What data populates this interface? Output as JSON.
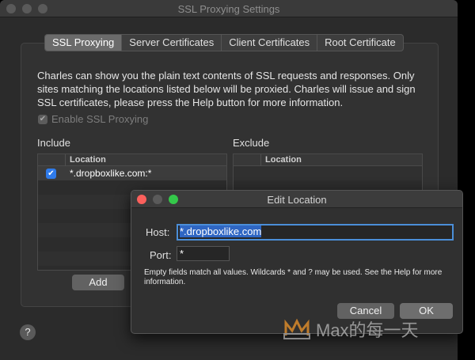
{
  "window": {
    "title": "SSL Proxying Settings"
  },
  "tabs": [
    {
      "label": "SSL Proxying",
      "active": true
    },
    {
      "label": "Server Certificates",
      "active": false
    },
    {
      "label": "Client Certificates",
      "active": false
    },
    {
      "label": "Root Certificate",
      "active": false
    }
  ],
  "description": "Charles can show you the plain text contents of SSL requests and responses. Only sites matching the locations listed below will be proxied. Charles will issue and sign SSL certificates, please press the Help button for more information.",
  "enable_ssl": {
    "label": "Enable SSL Proxying",
    "checked": true
  },
  "include": {
    "title": "Include",
    "column": "Location",
    "rows": [
      {
        "checked": true,
        "location": "*.dropboxlike.com:*"
      }
    ],
    "add_label": "Add"
  },
  "exclude": {
    "title": "Exclude",
    "column": "Location"
  },
  "help_label": "?",
  "dialog": {
    "title": "Edit Location",
    "host_label": "Host:",
    "host_value": "*.dropboxlike.com",
    "port_label": "Port:",
    "port_value": "*",
    "note": "Empty fields match all values. Wildcards * and ? may be used. See the Help for more information.",
    "cancel_label": "Cancel",
    "ok_label": "OK"
  },
  "watermark": {
    "text": "Max的每一天"
  },
  "colors": {
    "accent": "#2f7bea",
    "close": "#fc605c",
    "minimize_inactive": "#5a5a5a",
    "zoom": "#34c84a"
  }
}
